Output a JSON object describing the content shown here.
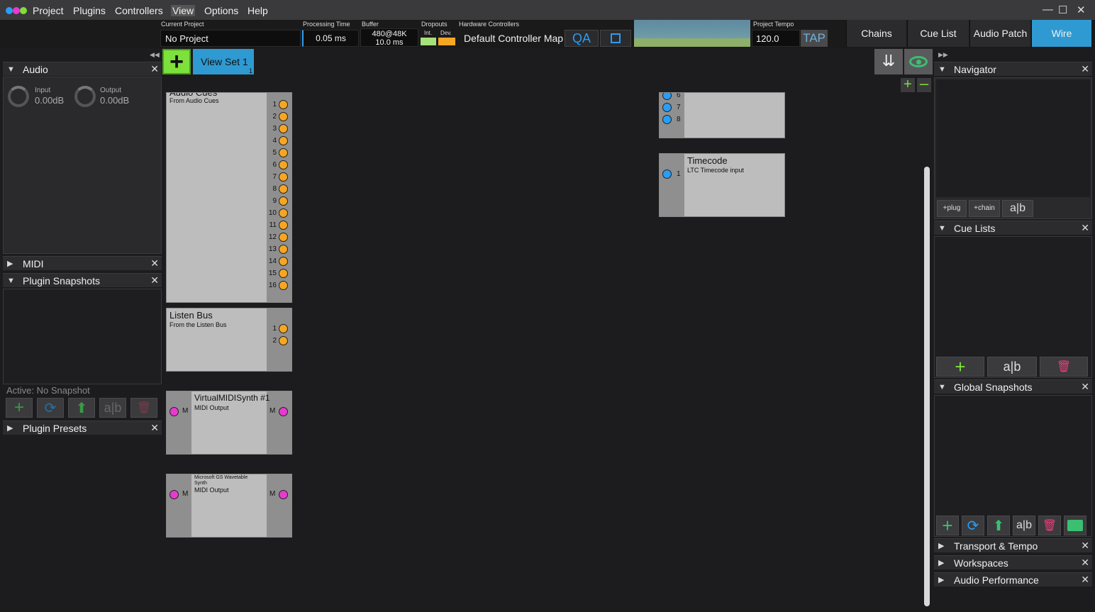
{
  "menu": {
    "items": [
      "Project",
      "Plugins",
      "Controllers",
      "View",
      "Options",
      "Help"
    ],
    "active": "View"
  },
  "info": {
    "current_project_label": "Current Project",
    "current_project": "No Project",
    "processing_label": "Processing Time",
    "processing_value": "0.05 ms",
    "buffer_label": "Buffer",
    "buffer_line1": "480@48K",
    "buffer_line2": "10.0 ms",
    "dropouts_label": "Dropouts",
    "dropouts_int": "Int.",
    "dropouts_dev": "Dev.",
    "hw_label": "Hardware Controllers",
    "hw_value": "Default Controller Map",
    "qa": "QA",
    "tempo_label": "Project Tempo",
    "tempo_value": "120.0",
    "tap": "TAP"
  },
  "tabs": {
    "chains": "Chains",
    "cue_list": "Cue List",
    "audio_patch": "Audio Patch",
    "wire": "Wire"
  },
  "left": {
    "audio_title": "Audio",
    "input_label": "Input",
    "input_value": "0.00dB",
    "output_label": "Output",
    "output_value": "0.00dB",
    "midi_title": "MIDI",
    "snapshots_title": "Plugin Snapshots",
    "snapshot_active": "Active: No Snapshot",
    "presets_title": "Plugin Presets",
    "ab_label": "a|b"
  },
  "viewset": {
    "label": "View Set 1",
    "index": "1"
  },
  "nodes": {
    "audio_cues": {
      "title": "Audio Cues",
      "sub": "From Audio Cues",
      "pins": [
        "1",
        "2",
        "3",
        "4",
        "5",
        "6",
        "7",
        "8",
        "9",
        "10",
        "11",
        "12",
        "13",
        "14",
        "15",
        "16"
      ]
    },
    "listen_bus": {
      "title": "Listen Bus",
      "sub": "From the Listen Bus",
      "pins": [
        "1",
        "2"
      ]
    },
    "vmidi": {
      "title": "VirtualMIDISynth #1",
      "sub": "MIDI Output",
      "pin_left": "M",
      "pin_right": "M"
    },
    "msgs": {
      "title": "Microsoft GS Wavetable Synth",
      "sub": "MIDI Output",
      "pin_left": "M",
      "pin_right": "M"
    },
    "top_right": {
      "pins": [
        "6",
        "7",
        "8"
      ]
    },
    "timecode": {
      "title": "Timecode",
      "sub": "LTC Timecode input",
      "pin": "1"
    }
  },
  "right": {
    "navigator_title": "Navigator",
    "plug_label": "+plug",
    "chain_label": "+chain",
    "ab_label": "a|b",
    "cue_lists_title": "Cue Lists",
    "global_snapshots_title": "Global Snapshots",
    "transport_title": "Transport & Tempo",
    "workspaces_title": "Workspaces",
    "audio_perf_title": "Audio Performance"
  },
  "colors": {
    "accent_blue": "#2f9ad2",
    "pin_orange": "#f5a623",
    "pin_blue": "#2a9df4",
    "pin_magenta": "#e83ad0",
    "add_green": "#7ee03a",
    "delete_pink": "#e8407a"
  }
}
